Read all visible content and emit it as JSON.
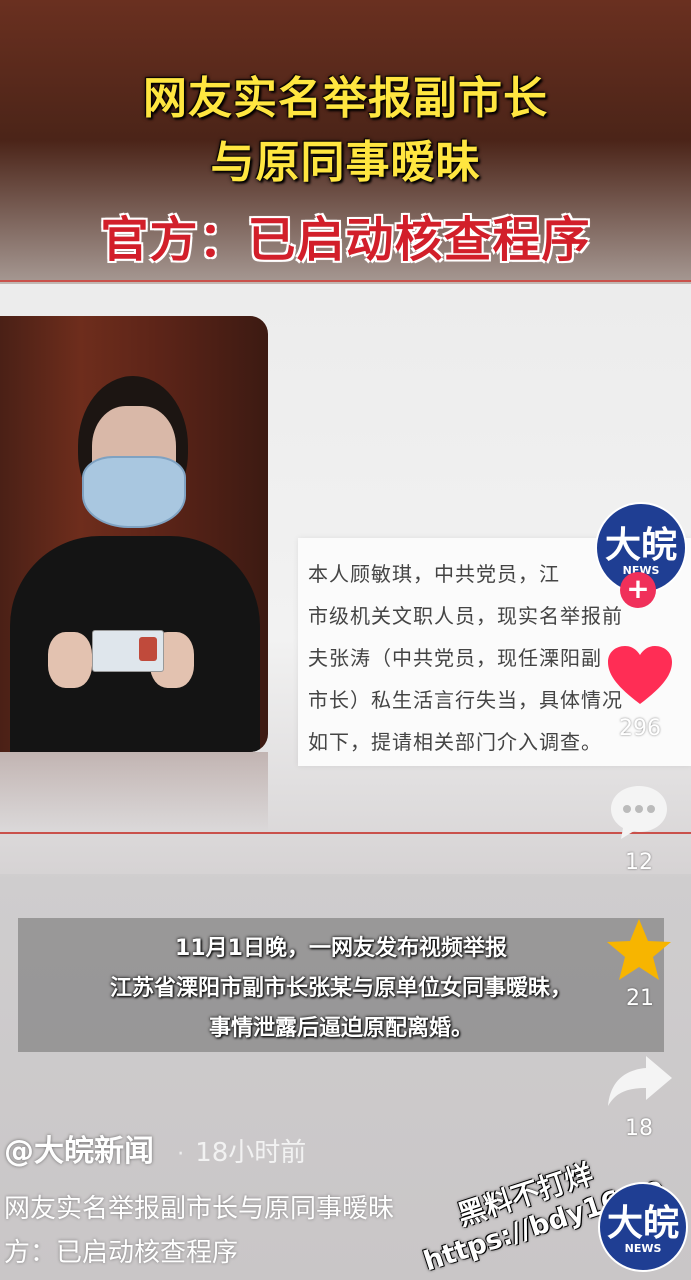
{
  "video": {
    "headline_line1": "网友实名举报副市长",
    "headline_line2": "与原同事暧昧",
    "headline_line3": "官方：已启动核查程序",
    "document_lines": [
      "本人顾敏琪，中共党员，江",
      "市级机关文职人员，现实名举报前",
      "夫张涛（中共党员，现任溧阳副",
      "市长）私生活言行失当，具体情况",
      "如下，提请相关部门介入调查。"
    ],
    "caption_lines": [
      "11月1日晚，一网友发布视频举报",
      "江苏省溧阳市副市长张某与原单位女同事暧昧，",
      "事情泄露后逼迫原配离婚。"
    ]
  },
  "sidebar": {
    "avatar_text": "大皖",
    "avatar_sub": "NEWS",
    "follow_symbol": "+",
    "like_count": "296",
    "comment_count": "12",
    "favorite_count": "21",
    "share_count": "18"
  },
  "post": {
    "username": "@大皖新闻",
    "separator": "·",
    "time": "18小时前",
    "desc_line1": "网友实名举报副市长与原同事暧昧",
    "desc_line2": "方：已启动核查程序"
  },
  "watermark": {
    "text_line1": "黑料不打烊",
    "text_line2": "https://bdy16.co",
    "logo_text": "大皖",
    "logo_sub": "NEWS"
  },
  "colors": {
    "headline_yellow": "#ffe640",
    "headline_red": "#d21f2a",
    "like_red": "#ff2d55",
    "favorite_gold": "#f7b500",
    "brand_blue": "#1f3e93"
  },
  "icons": [
    "heart-icon",
    "comment-icon",
    "star-icon",
    "share-icon",
    "plus-icon"
  ]
}
